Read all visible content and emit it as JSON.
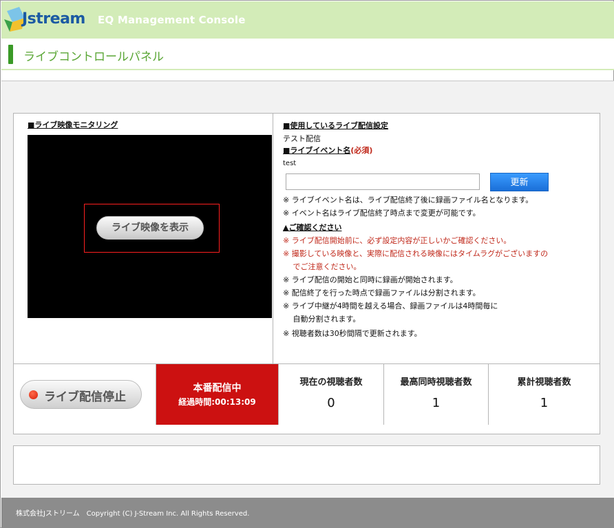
{
  "header": {
    "logo_text": "Jstream",
    "app_title": "EQ Management Console"
  },
  "page": {
    "title": "ライブコントロールパネル"
  },
  "monitor": {
    "heading": "■ライブ映像モニタリング",
    "show_button": "ライブ映像を表示"
  },
  "settings": {
    "heading": "■使用しているライブ配信設定",
    "value": "テスト配信",
    "event_name_heading": "■ライブイベント名",
    "required_label": "(必須)",
    "event_name_value": "test",
    "input_value": "",
    "update_button": "更新",
    "notes": [
      "※ ライブイベント名は、ライブ配信終了後に録画ファイル名となります。",
      "※ イベント名はライブ配信終了時点まで変更が可能です。"
    ]
  },
  "confirm": {
    "heading": "▲ご確認ください",
    "red_notes": [
      "※ ライブ配信開始前に、必ず設定内容が正しいかご確認ください。",
      "※ 撮影している映像と、実際に配信される映像にはタイムラグがございますの",
      "　 でご注意ください。"
    ],
    "notes": [
      "※ ライブ配信の開始と同時に録画が開始されます。",
      "※ 配信終了を行った時点で録画ファイルは分割されます。",
      "※ ライブ中継が4時間を越える場合、録画ファイルは4時間毎に",
      "　 自動分割されます。",
      "※ 視聴者数は30秒間隔で更新されます。"
    ]
  },
  "status": {
    "stop_button": "ライブ配信停止",
    "live_title": "本番配信中",
    "elapsed": "経過時間:00:13:09",
    "current_viewers_label": "現在の視聴者数",
    "current_viewers": "0",
    "peak_viewers_label": "最高同時視聴者数",
    "peak_viewers": "1",
    "total_viewers_label": "累計視聴者数",
    "total_viewers": "1"
  },
  "footer": {
    "text": "株式会社Jストリーム　Copyright (C) J-Stream Inc. All Rights Reserved."
  },
  "colors": {
    "header_bg": "#d3ecb8",
    "accent_green": "#3a9a27",
    "live_red": "#cc1111",
    "update_blue": "#1a6fd8",
    "footer_bg": "#8c8c8c"
  }
}
